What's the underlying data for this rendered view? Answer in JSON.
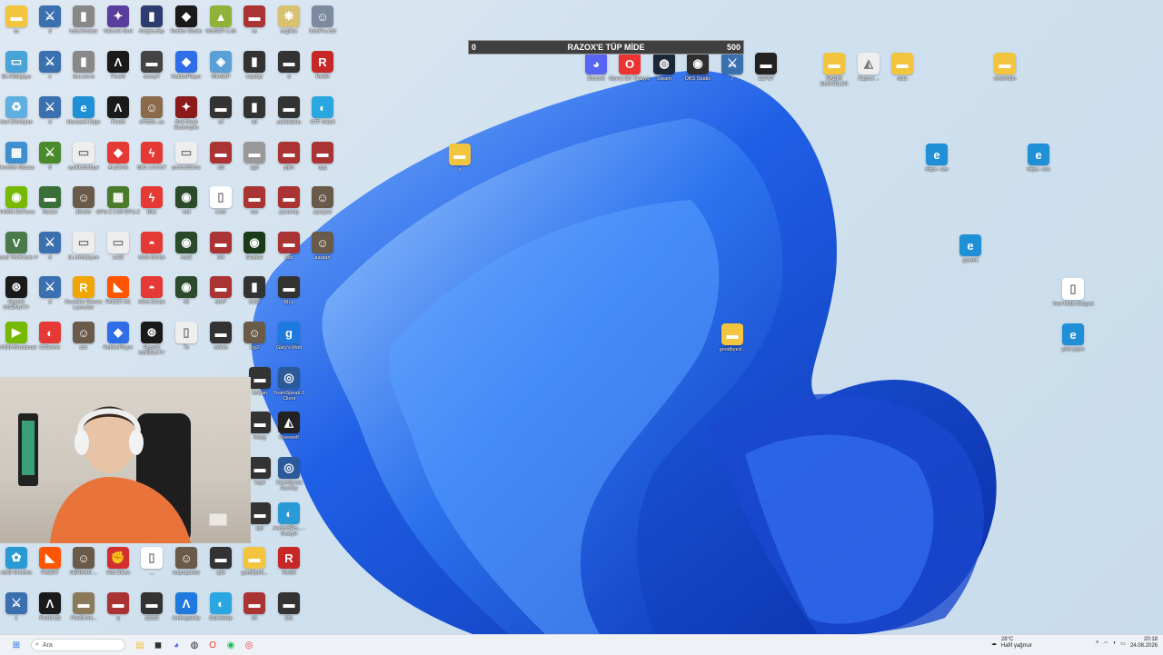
{
  "progress_bar": {
    "title": "RAZOX'E TÜP MİDE",
    "min": "0",
    "max": "500",
    "fill_fraction": 0.0
  },
  "taskbar": {
    "search_placeholder": "Ara",
    "weather_temp": "28°C",
    "weather_desc": "Hafif yağmur",
    "time": "20:18",
    "date": "24.08.2026"
  },
  "icons": [
    {
      "id": "i1",
      "label": "ss",
      "c": "#f3c53e",
      "g": "▬"
    },
    {
      "id": "i2",
      "label": "d",
      "c": "#3a6fb0",
      "g": "⚔"
    },
    {
      "id": "i3",
      "label": "hdsvidmamir",
      "c": "#888",
      "g": "▮"
    },
    {
      "id": "i4",
      "label": "Vikti.net Seni",
      "c": "#5a3e9e",
      "g": "✦"
    },
    {
      "id": "i5",
      "label": "thogan.dsp",
      "c": "#2e3b6e",
      "g": "▮"
    },
    {
      "id": "i6",
      "label": "Roblox Studio",
      "c": "#1a1a1a",
      "g": "◆"
    },
    {
      "id": "i7",
      "label": "WinSCP-1.36",
      "c": "#8fb33a",
      "g": "▲"
    },
    {
      "id": "i8",
      "label": "xx",
      "c": "#a33",
      "g": "▬"
    },
    {
      "id": "i9",
      "label": "oxglitez",
      "c": "#d8c170",
      "g": "❋"
    },
    {
      "id": "i10",
      "label": "İlmaPre.c3d",
      "c": "#7c8aa0",
      "g": "☺"
    },
    {
      "id": "i11",
      "label": "Ek-Hilaligayo",
      "c": "#4aa3d6",
      "g": "▭"
    },
    {
      "id": "i12",
      "label": "v",
      "c": "#3a6fb0",
      "g": "⚔"
    },
    {
      "id": "i13",
      "label": "itoo.ser.m",
      "c": "#888",
      "g": "▮"
    },
    {
      "id": "i14",
      "label": "PiveM",
      "c": "#1a1a1a",
      "g": "Λ"
    },
    {
      "id": "i15",
      "label": "ooooyT",
      "c": "#444",
      "g": "▬"
    },
    {
      "id": "i16",
      "label": "RobloxPlayer",
      "c": "#2f6ee8",
      "g": "◆"
    },
    {
      "id": "i17",
      "label": "WinSCP",
      "c": "#5aa0d6",
      "g": "◈"
    },
    {
      "id": "i18",
      "label": "vaysbyr",
      "c": "#333",
      "g": "▮"
    },
    {
      "id": "i19",
      "label": "d",
      "c": "#333",
      "g": "▬"
    },
    {
      "id": "i20",
      "label": "RedM",
      "c": "#c62828",
      "g": "R"
    },
    {
      "id": "i21",
      "label": "Geri Dönüşüm",
      "c": "#5fb0e0",
      "g": "♻"
    },
    {
      "id": "i22",
      "label": "d",
      "c": "#3a6fb0",
      "g": "⚔"
    },
    {
      "id": "i23",
      "label": "Microsoft Edge",
      "c": "#1f8fd6",
      "g": "e"
    },
    {
      "id": "i24",
      "label": "FiveM",
      "c": "#1a1a1a",
      "g": "Λ"
    },
    {
      "id": "i25",
      "label": "d7552c..ca",
      "c": "#8a6a4a",
      "g": "☺"
    },
    {
      "id": "i26",
      "label": "Red Dead Redemptio",
      "c": "#8b1a1a",
      "g": "✦"
    },
    {
      "id": "i27",
      "label": "c3",
      "c": "#333",
      "g": "▬"
    },
    {
      "id": "i28",
      "label": "ad",
      "c": "#333",
      "g": "▮"
    },
    {
      "id": "i29",
      "label": "yoktaldsdu",
      "c": "#333",
      "g": "▬"
    },
    {
      "id": "i30",
      "label": "GTF Install",
      "c": "#2aa7e0",
      "g": "◐"
    },
    {
      "id": "i31",
      "label": "Denetim Masası",
      "c": "#3f8fd0",
      "g": "▦"
    },
    {
      "id": "i32",
      "label": "d",
      "c": "#4a8a2a",
      "g": "⚔"
    },
    {
      "id": "i33",
      "label": "ayakkabıdaye",
      "c": "#eee",
      "g": "▭"
    },
    {
      "id": "i34",
      "label": "AnyDesk",
      "c": "#e53935",
      "g": "◆"
    },
    {
      "id": "i35",
      "label": "Blitz-1.0.6.57",
      "c": "#e53935",
      "g": "ϟ"
    },
    {
      "id": "i36",
      "label": "psdcnd3amo",
      "c": "#eee",
      "g": "▭"
    },
    {
      "id": "i37",
      "label": "aid",
      "c": "#a33",
      "g": "▬"
    },
    {
      "id": "i38",
      "label": "agd",
      "c": "#999",
      "g": "▬"
    },
    {
      "id": "i39",
      "label": "pijkn",
      "c": "#a33",
      "g": "▬"
    },
    {
      "id": "i40",
      "label": "qqq",
      "c": "#a33",
      "g": "▬"
    },
    {
      "id": "i41",
      "label": "NVIDIA GeForce",
      "c": "#76b900",
      "g": "◉"
    },
    {
      "id": "i42",
      "label": "Navtor",
      "c": "#3a6f3a",
      "g": "▬"
    },
    {
      "id": "i43",
      "label": "dönder",
      "c": "#6a5a4a",
      "g": "☺"
    },
    {
      "id": "i44",
      "label": "GPU-Z 2.60 GPU-Z",
      "c": "#4a7a2a",
      "g": "▦"
    },
    {
      "id": "i45",
      "label": "Blitz",
      "c": "#e53935",
      "g": "ϟ"
    },
    {
      "id": "i46",
      "label": "vod",
      "c": "#2a4a2a",
      "g": "◉"
    },
    {
      "id": "i47",
      "label": "Liste",
      "c": "#fff",
      "g": "▯"
    },
    {
      "id": "i48",
      "label": "ww",
      "c": "#a33",
      "g": "▬"
    },
    {
      "id": "i49",
      "label": "aynamsy",
      "c": "#a33",
      "g": "▬"
    },
    {
      "id": "i50",
      "label": "aynayse",
      "c": "#6a5a4a",
      "g": "☺"
    },
    {
      "id": "i51",
      "label": "Grand Theft Auto V",
      "c": "#4a7a4a",
      "g": "V"
    },
    {
      "id": "i52",
      "label": "d",
      "c": "#3a6fb0",
      "g": "⚔"
    },
    {
      "id": "i53",
      "label": "ilk.emulasyon",
      "c": "#eee",
      "g": "▭"
    },
    {
      "id": "i54",
      "label": "ac22",
      "c": "#eee",
      "g": "▭"
    },
    {
      "id": "i55",
      "label": "Mem Denizi",
      "c": "#e53935",
      "g": "◓"
    },
    {
      "id": "i56",
      "label": "nsa3",
      "c": "#2a4a2a",
      "g": "◉"
    },
    {
      "id": "i57",
      "label": "3/4",
      "c": "#a33",
      "g": "▬"
    },
    {
      "id": "i58",
      "label": "Grabee",
      "c": "#1a3a1a",
      "g": "◉"
    },
    {
      "id": "i59",
      "label": "asb",
      "c": "#a33",
      "g": "▬"
    },
    {
      "id": "i60",
      "label": "aaraan",
      "c": "#6a5a4a",
      "g": "☺"
    },
    {
      "id": "i61",
      "label": "HyperX NGENUITY",
      "c": "#1a1a1a",
      "g": "⊛"
    },
    {
      "id": "i62",
      "label": "d",
      "c": "#3a6fb0",
      "g": "⚔"
    },
    {
      "id": "i63",
      "label": "Rockstar Games Launcher",
      "c": "#f0a500",
      "g": "R"
    },
    {
      "id": "i64",
      "label": "FACEIT AC",
      "c": "#ff5500",
      "g": "◣"
    },
    {
      "id": "i65",
      "label": "Mem Denizi",
      "c": "#e53935",
      "g": "◓"
    },
    {
      "id": "i66",
      "label": "45",
      "c": "#2a4a2a",
      "g": "◉"
    },
    {
      "id": "i67",
      "label": "ah47",
      "c": "#a33",
      "g": "▬"
    },
    {
      "id": "i68",
      "label": "3182",
      "c": "#333",
      "g": "▮"
    },
    {
      "id": "i69",
      "label": "BILL",
      "c": "#333",
      "g": "▬"
    },
    {
      "id": "i70",
      "label": "NVIDIA Broadcast",
      "c": "#76b900",
      "g": "▶"
    },
    {
      "id": "i71",
      "label": "CCleaner",
      "c": "#e53935",
      "g": "◐"
    },
    {
      "id": "i72",
      "label": "ariz",
      "c": "#6a5a4a",
      "g": "☺"
    },
    {
      "id": "i73",
      "label": "RobloxPlayer",
      "c": "#2f6ee8",
      "g": "◆"
    },
    {
      "id": "i74",
      "label": "HyperX NGENUITY",
      "c": "#1a1a1a",
      "g": "⊛"
    },
    {
      "id": "i75",
      "label": "Tx",
      "c": "#eee",
      "g": "▯"
    },
    {
      "id": "i76",
      "label": "rafe4s",
      "c": "#333",
      "g": "▬"
    },
    {
      "id": "i77",
      "label": "ikg2",
      "c": "#6a5a4a",
      "g": "☺"
    },
    {
      "id": "i78",
      "label": "Gary's Mod",
      "c": "#1f7ae0",
      "g": "g"
    },
    {
      "id": "i79",
      "label": "kodlan",
      "c": "#333",
      "g": "▬"
    },
    {
      "id": "i80",
      "label": "TeamSpeak 3 Client",
      "c": "#2a5a9a",
      "g": "◎"
    },
    {
      "id": "i81",
      "label": "hrazg",
      "c": "#333",
      "g": "▬"
    },
    {
      "id": "i82",
      "label": "Overwolf",
      "c": "#222",
      "g": "◭"
    },
    {
      "id": "i83",
      "label": "kayit",
      "c": "#333",
      "g": "▬"
    },
    {
      "id": "i84",
      "label": "TeamSpeak Overlay",
      "c": "#2a5a9a",
      "g": "◎"
    },
    {
      "id": "i85",
      "label": "ayir",
      "c": "#333",
      "g": "▬"
    },
    {
      "id": "i86",
      "label": "AndroidEm... - Kısayol",
      "c": "#2a9ad6",
      "g": "◐"
    },
    {
      "id": "i87",
      "label": "AMD Omnitrix",
      "c": "#2a9ad6",
      "g": "✿"
    },
    {
      "id": "i88",
      "label": "FACEIT",
      "c": "#ff5500",
      "g": "◣"
    },
    {
      "id": "i89",
      "label": "HERMAN ...",
      "c": "#6a5a4a",
      "g": "☺"
    },
    {
      "id": "i90",
      "label": "Riot Client",
      "c": "#d32f2f",
      "g": "✊"
    },
    {
      "id": "i91",
      "label": "...",
      "c": "#fff",
      "g": "▯"
    },
    {
      "id": "i92",
      "label": "kopuspantsi",
      "c": "#6a5a4a",
      "g": "☺"
    },
    {
      "id": "i93",
      "label": "q23",
      "c": "#333",
      "g": "▬"
    },
    {
      "id": "i94",
      "label": "goodbyed...",
      "c": "#f3c53e",
      "g": "▬"
    },
    {
      "id": "i95",
      "label": "RedM",
      "c": "#c62828",
      "g": "R"
    },
    {
      "id": "i96",
      "label": "1",
      "c": "#3a6fb0",
      "g": "⚔"
    },
    {
      "id": "i97",
      "label": "FiveM (2)",
      "c": "#1a1a1a",
      "g": "Λ"
    },
    {
      "id": "i98",
      "label": "FiveM.lmr...",
      "c": "#8a7a5a",
      "g": "▬"
    },
    {
      "id": "i99",
      "label": "q",
      "c": "#a33",
      "g": "▬"
    },
    {
      "id": "i100",
      "label": "22222",
      "c": "#333",
      "g": "▬"
    },
    {
      "id": "i101",
      "label": "Androgravity",
      "c": "#1f7ae0",
      "g": "Λ"
    },
    {
      "id": "i102",
      "label": "Gameloop",
      "c": "#2aa7e0",
      "g": "◐"
    },
    {
      "id": "i103",
      "label": "34",
      "c": "#a33",
      "g": "▬"
    },
    {
      "id": "i104",
      "label": "231",
      "c": "#333",
      "g": "▬"
    },
    {
      "id": "i105",
      "label": "Discord",
      "c": "#5865f2",
      "g": "◕"
    },
    {
      "id": "i106",
      "label": "Opera GX Tarayıcı",
      "c": "#e33",
      "g": "O"
    },
    {
      "id": "i107",
      "label": "Steam",
      "c": "#1b2838",
      "g": "◍"
    },
    {
      "id": "i108",
      "label": "OBS Studio",
      "c": "#302e31",
      "g": "◉"
    },
    {
      "id": "i109",
      "label": "7",
      "c": "#3a6fb0",
      "g": "⚔"
    },
    {
      "id": "i110",
      "label": "2ΔFSF",
      "c": "#222",
      "g": "▬"
    },
    {
      "id": "i111",
      "label": "RASIM EMOTELER",
      "c": "#f3c53e",
      "g": "▬"
    },
    {
      "id": "i112",
      "label": "Capcut ...",
      "c": "#eee",
      "g": "◭"
    },
    {
      "id": "i113",
      "label": "data",
      "c": "#f3c53e",
      "g": "▬"
    },
    {
      "id": "i114",
      "label": "ortwerdsn",
      "c": "#f3c53e",
      "g": "▬"
    },
    {
      "id": "i115",
      "label": "s",
      "c": "#f3c53e",
      "g": "▬"
    },
    {
      "id": "i116",
      "label": "https---ww",
      "c": "#1f8fd6",
      "g": "e"
    },
    {
      "id": "i117",
      "label": "https---ww",
      "c": "#1f8fd6",
      "g": "e"
    },
    {
      "id": "i118",
      "label": "garanti",
      "c": "#1f8fd6",
      "g": "e"
    },
    {
      "id": "i119",
      "label": "Yeni Metin Belgesi",
      "c": "#fff",
      "g": "▯"
    },
    {
      "id": "i120",
      "label": "goodbyed...",
      "c": "#f3c53e",
      "g": "▬"
    },
    {
      "id": "i121",
      "label": "yeni yayın",
      "c": "#1f8fd6",
      "g": "e"
    }
  ],
  "taskbar_pins": [
    {
      "name": "file-explorer",
      "g": "▤",
      "c": "#f3c53e"
    },
    {
      "name": "store",
      "g": "◼",
      "c": "#333"
    },
    {
      "name": "discord",
      "g": "◕",
      "c": "#5865f2"
    },
    {
      "name": "steam",
      "g": "◍",
      "c": "#1b2838"
    },
    {
      "name": "opera",
      "g": "O",
      "c": "#e33"
    },
    {
      "name": "spotify",
      "g": "◉",
      "c": "#1db954"
    },
    {
      "name": "chrome",
      "g": "◎",
      "c": "#e53935"
    }
  ]
}
